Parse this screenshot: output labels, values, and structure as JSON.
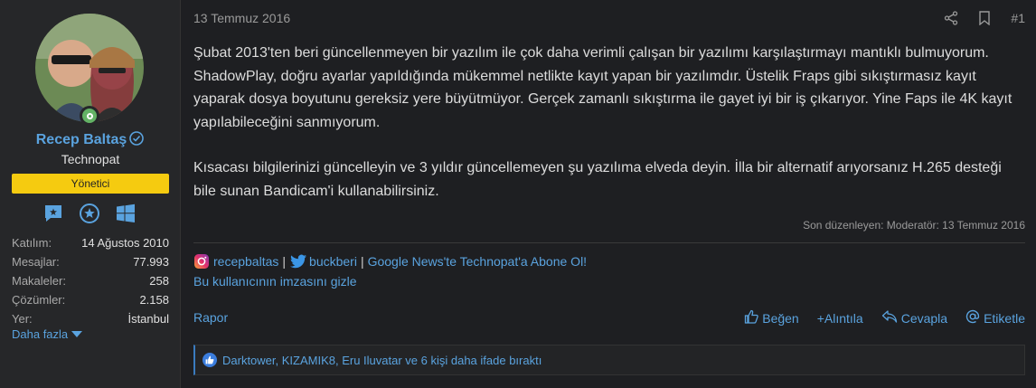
{
  "user": {
    "name": "Recep Baltaş",
    "title": "Technopat",
    "role": "Yönetici",
    "stats": [
      {
        "label": "Katılım:",
        "value": "14 Ağustos 2010"
      },
      {
        "label": "Mesajlar:",
        "value": "77.993"
      },
      {
        "label": "Makaleler:",
        "value": "258"
      },
      {
        "label": "Çözümler:",
        "value": "2.158"
      },
      {
        "label": "Yer:",
        "value": "İstanbul"
      }
    ],
    "more_label": "Daha fazla"
  },
  "post": {
    "date": "13 Temmuz 2016",
    "number": "#1",
    "paragraphs": [
      "Şubat 2013'ten beri güncellenmeyen bir yazılım ile çok daha verimli çalışan bir yazılımı karşılaştırmayı mantıklı bulmuyorum. ShadowPlay, doğru ayarlar yapıldığında mükemmel netlikte kayıt yapan bir yazılımdır. Üstelik Fraps gibi sıkıştırmasız kayıt yaparak dosya boyutunu gereksiz yere büyütmüyor. Gerçek zamanlı sıkıştırma ile gayet iyi bir iş çıkarıyor. Yine Faps ile 4K kayıt yapılabileceğini sanmıyorum.",
      "Kısacası bilgilerinizi güncelleyin ve 3 yıldır güncellemeyen şu yazılıma elveda deyin. İlla bir alternatif arıyorsanız H.265 desteği bile sunan Bandicam'i kullanabilirsiniz."
    ],
    "edited": "Son düzenleyen: Moderatör: 13 Temmuz 2016"
  },
  "signature": {
    "instagram": "recepbaltas",
    "twitter": "buckberi",
    "pipe": "|",
    "news": "Google News'te Technopat'a Abone Ol!",
    "hide": "Bu kullanıcının imzasını gizle"
  },
  "footer": {
    "report": "Rapor",
    "like": "Beğen",
    "quote": "+Alıntıla",
    "reply": "Cevapla",
    "tag": "Etiketle"
  },
  "reactions": {
    "text": "Darktower, KIZAMIK8, Eru Iluvatar ve 6 kişi daha ifade bıraktı"
  },
  "colors": {
    "link": "#5aa3df",
    "badge": "#f5cb10",
    "online": "#63b265",
    "background": "#1e1f22"
  }
}
